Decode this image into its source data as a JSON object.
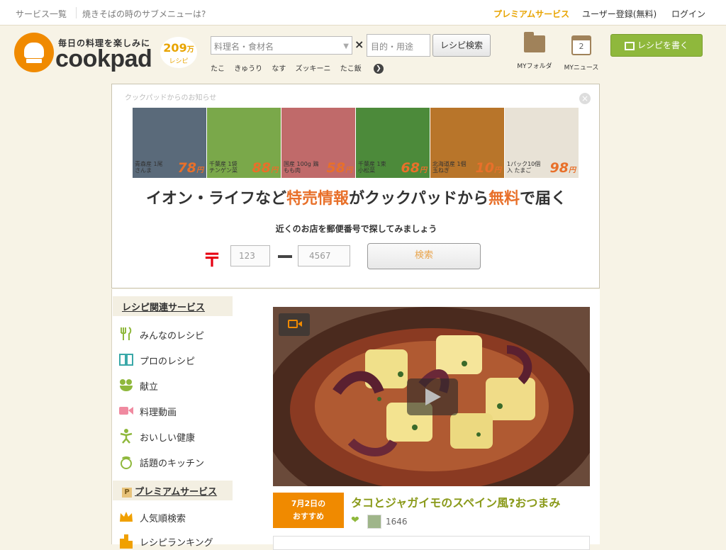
{
  "topbar": {
    "service_list": "サービス一覧",
    "menu_question": "焼きそばの時のサブメニューは?",
    "premium": "プレミアムサービス",
    "register": "ユーザー登録(無料)",
    "login": "ログイン"
  },
  "logo": {
    "tagline": "毎日の料理を楽しみに",
    "word": "cookpad",
    "recipe_count": "209",
    "recipe_unit": "万",
    "recipe_label": "レシピ"
  },
  "search": {
    "placeholder_main": "料理名・食材名",
    "cross": "×",
    "placeholder_purpose": "目的・用途",
    "button": "レシピ検索",
    "quick_keywords": [
      "たこ",
      "きゅうり",
      "なす",
      "ズッキーニ",
      "たこ飯"
    ],
    "more_arrow": "❯"
  },
  "header_actions": {
    "my_folder": "MYフォルダ",
    "my_news": "MYニュース",
    "my_news_count": "2",
    "write_recipe": "レシピを書く"
  },
  "notice": {
    "title": "クックパッドからのお知らせ",
    "close": "×",
    "tiles": [
      {
        "label": "青森産 1尾 さんま",
        "price": "78",
        "unit": "円",
        "bg": "#5a6a7a"
      },
      {
        "label": "千葉産 1袋 チンゲン菜",
        "price": "88",
        "unit": "円",
        "bg": "#7aa84a"
      },
      {
        "label": "国産 100g 鶏もも肉",
        "price": "58",
        "unit": "円",
        "bg": "#c06a6a"
      },
      {
        "label": "千葉産 1束 小松菜",
        "price": "68",
        "unit": "円",
        "bg": "#4c8a3a"
      },
      {
        "label": "北海道産 1個 玉ねぎ",
        "price": "10",
        "unit": "円",
        "bg": "#b8752a"
      },
      {
        "label": "1パック10個入 たまご",
        "price": "98",
        "unit": "円",
        "bg": "#e8e2d6"
      }
    ],
    "headline_a": "イオン・ライフなど",
    "headline_b": "特売情報",
    "headline_c": "がクックパッドから",
    "headline_d": "無料",
    "headline_e": "で届く",
    "sub": "近くのお店を郵便番号で探してみましょう",
    "postal_mark": "〒",
    "zip1_placeholder": "123",
    "zip2_placeholder": "4567",
    "search_button": "検索"
  },
  "sidebar": {
    "section1": "レシピ関連サービス",
    "items1": [
      "みんなのレシピ",
      "プロのレシピ",
      "献立",
      "料理動画",
      "おいしい健康",
      "話題のキッチン"
    ],
    "section2": "プレミアムサービス",
    "section2_badge": "P",
    "items2": [
      "人気順検索",
      "レシピランキング"
    ]
  },
  "feature": {
    "date_line1": "7月2日の",
    "date_line2": "おすすめ",
    "title": "タコとジャガイモのスペイン風?おつまみ",
    "heart": "❤",
    "likes": "1646"
  },
  "colors": {
    "accent_orange": "#f08a00",
    "green": "#8fb83c",
    "premium_gold": "#e8a400"
  }
}
